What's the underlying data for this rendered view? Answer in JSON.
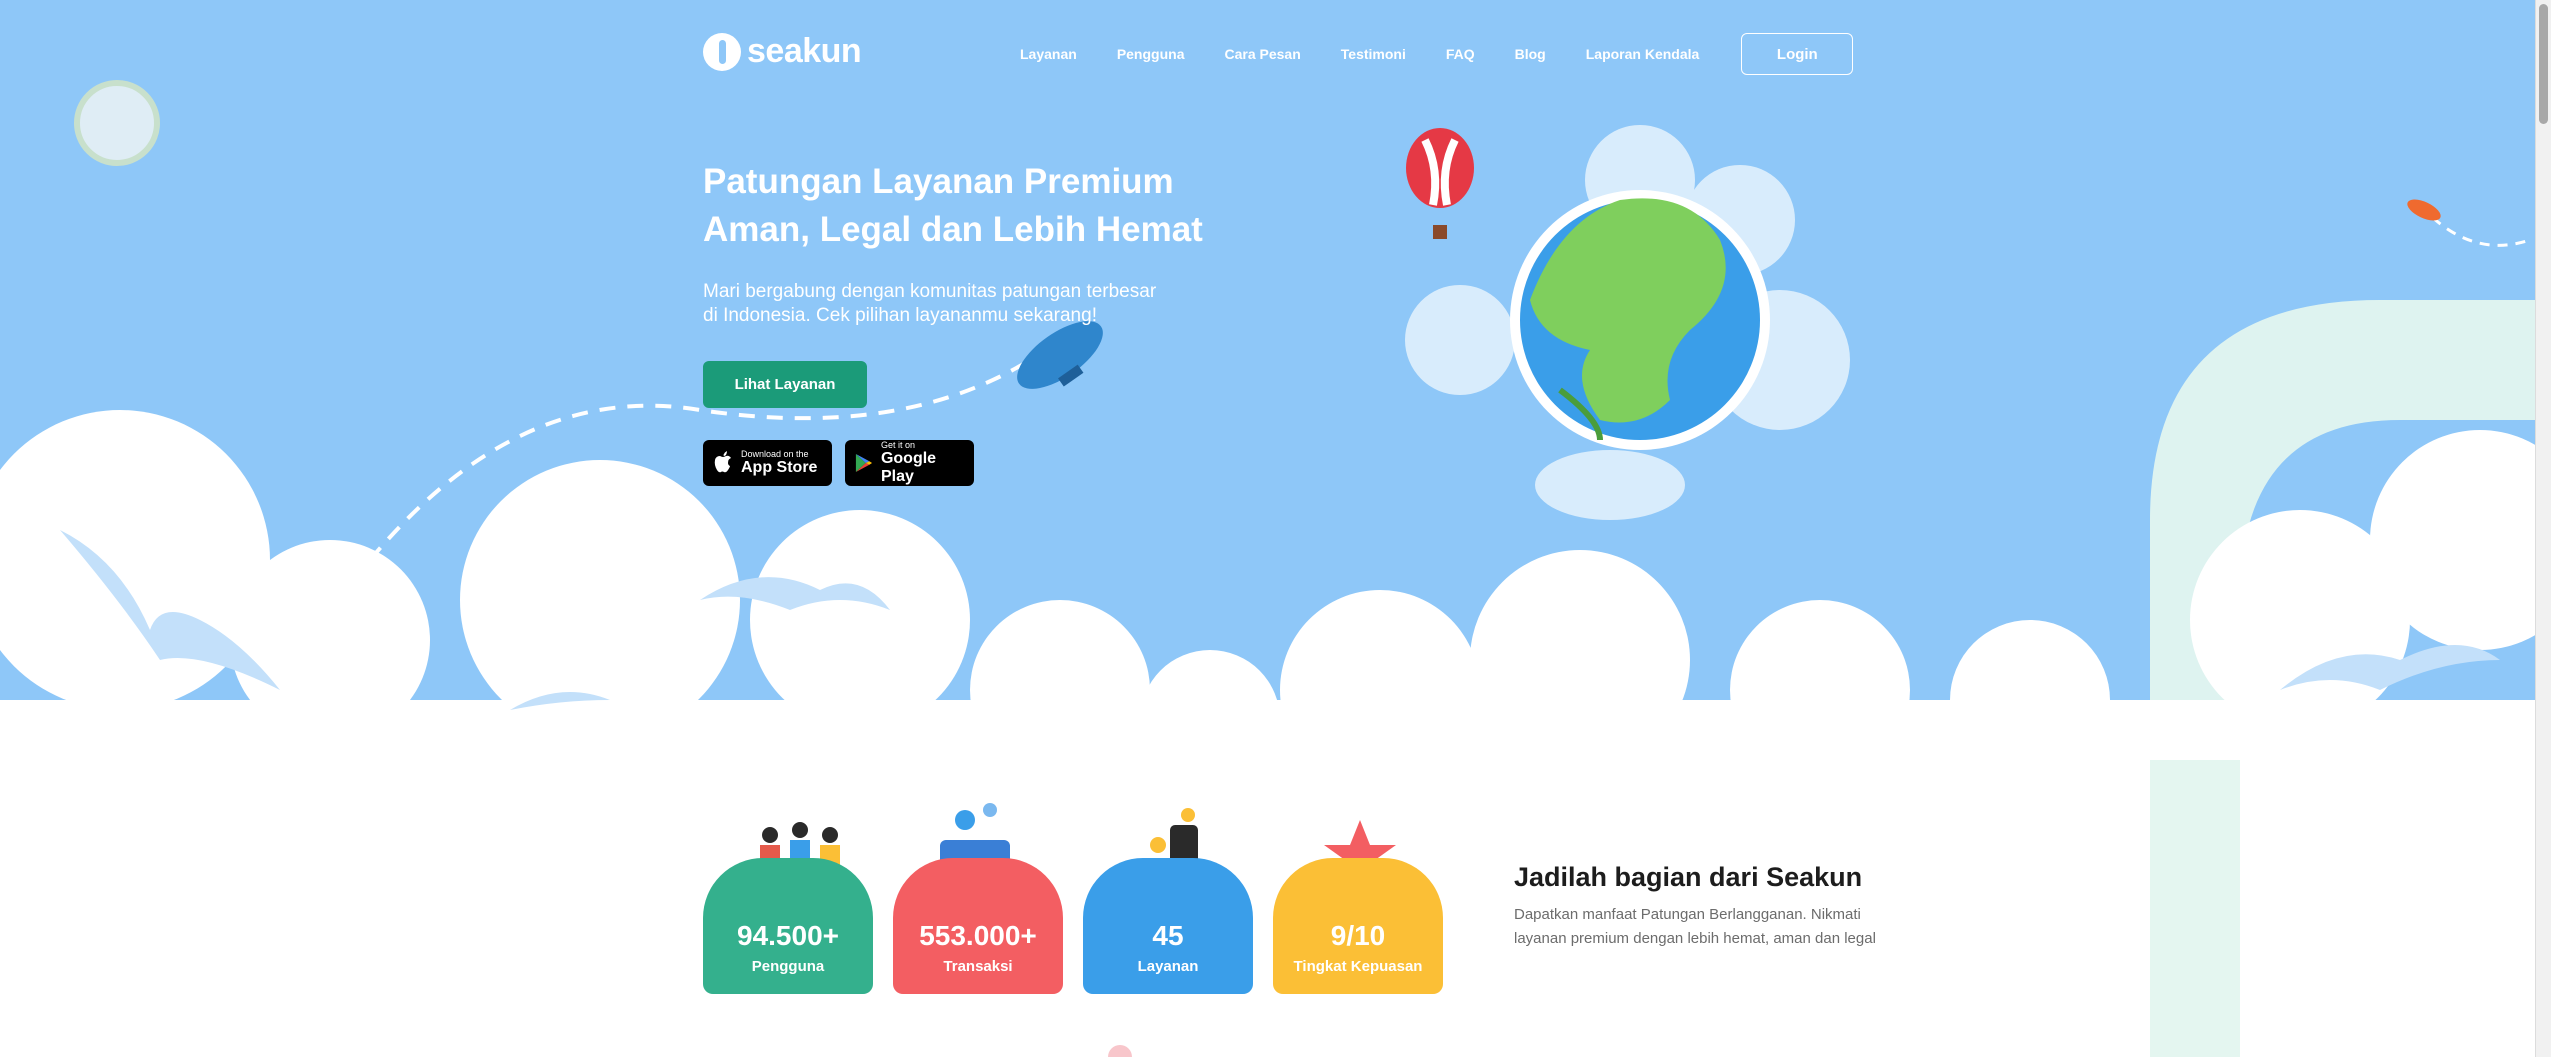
{
  "brand": {
    "name": "seakun"
  },
  "nav": {
    "items": [
      "Layanan",
      "Pengguna",
      "Cara Pesan",
      "Testimoni",
      "FAQ",
      "Blog",
      "Laporan Kendala"
    ],
    "login_label": "Login"
  },
  "hero": {
    "title_line1": "Patungan Layanan Premium",
    "title_line2": "Aman, Legal dan Lebih Hemat",
    "subtitle_line1": "Mari bergabung dengan komunitas patungan terbesar",
    "subtitle_line2": "di Indonesia. Cek pilihan layananmu sekarang!",
    "cta_label": "Lihat Layanan",
    "appstore_small": "Download on the",
    "appstore_big": "App Store",
    "gplay_small": "Get it on",
    "gplay_big": "Google Play"
  },
  "stats": [
    {
      "value": "94.500+",
      "label": "Pengguna",
      "color": "#34b08d"
    },
    {
      "value": "553.000+",
      "label": "Transaksi",
      "color": "#f35e62"
    },
    {
      "value": "45",
      "label": "Layanan",
      "color": "#3a9ee9"
    },
    {
      "value": "9/10",
      "label": "Tingkat Kepuasan",
      "color": "#fbbf36"
    }
  ],
  "join": {
    "title": "Jadilah bagian dari Seakun",
    "desc_line1": "Dapatkan manfaat Patungan Berlangganan. Nikmati",
    "desc_line2": "layanan premium dengan lebih hemat, aman dan legal"
  },
  "colors": {
    "sky": "#8ec7f8",
    "cta": "#1b9b79"
  }
}
